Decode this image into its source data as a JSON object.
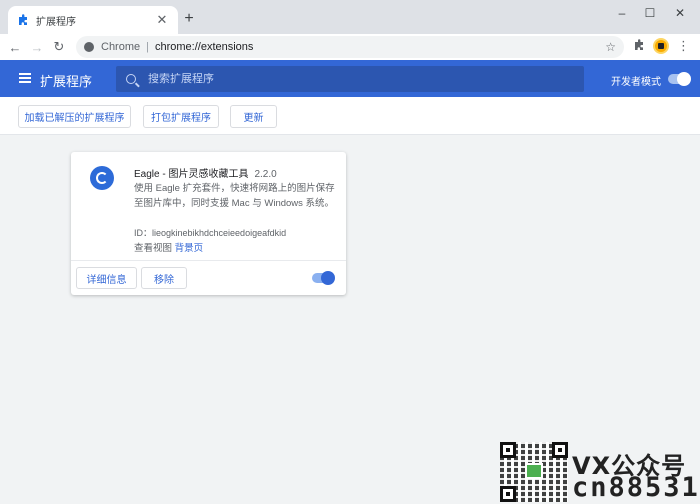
{
  "browser": {
    "tab_title": "扩展程序",
    "tab_close": "✕",
    "new_tab": "+",
    "window_controls": {
      "minimize": "–",
      "maximize": "☐",
      "close": "✕"
    },
    "nav": {
      "back": "←",
      "forward": "→",
      "reload": "↻"
    },
    "omnibox": {
      "host": "Chrome",
      "separator": "|",
      "url": "chrome://extensions"
    },
    "star": "☆",
    "menu": "⋮"
  },
  "header": {
    "title": "扩展程序",
    "search_placeholder": "搜索扩展程序",
    "dev_mode_label": "开发者模式",
    "dev_mode_on": true
  },
  "toolbar": {
    "load_unpacked": "加载已解压的扩展程序",
    "pack": "打包扩展程序",
    "update": "更新"
  },
  "extension": {
    "name": "Eagle - 图片灵感收藏工具",
    "version": "2.2.0",
    "description": "使用 Eagle 扩充套件，快速将网路上的图片保存至图片库中，同时支援 Mac 与 Windows 系统。",
    "id_line": "ID：lieogkinebikhdchceieedoigeafdkid",
    "inspect_label": "查看视图",
    "inspect_link": "背景页",
    "details_button": "详细信息",
    "remove_button": "移除",
    "enabled": true
  },
  "watermark": {
    "line1": "VX公众号",
    "line2": "cn88531"
  },
  "colors": {
    "header_blue": "#3367d6",
    "link_blue": "#3367d6",
    "tabstrip": "#dee1e6"
  }
}
